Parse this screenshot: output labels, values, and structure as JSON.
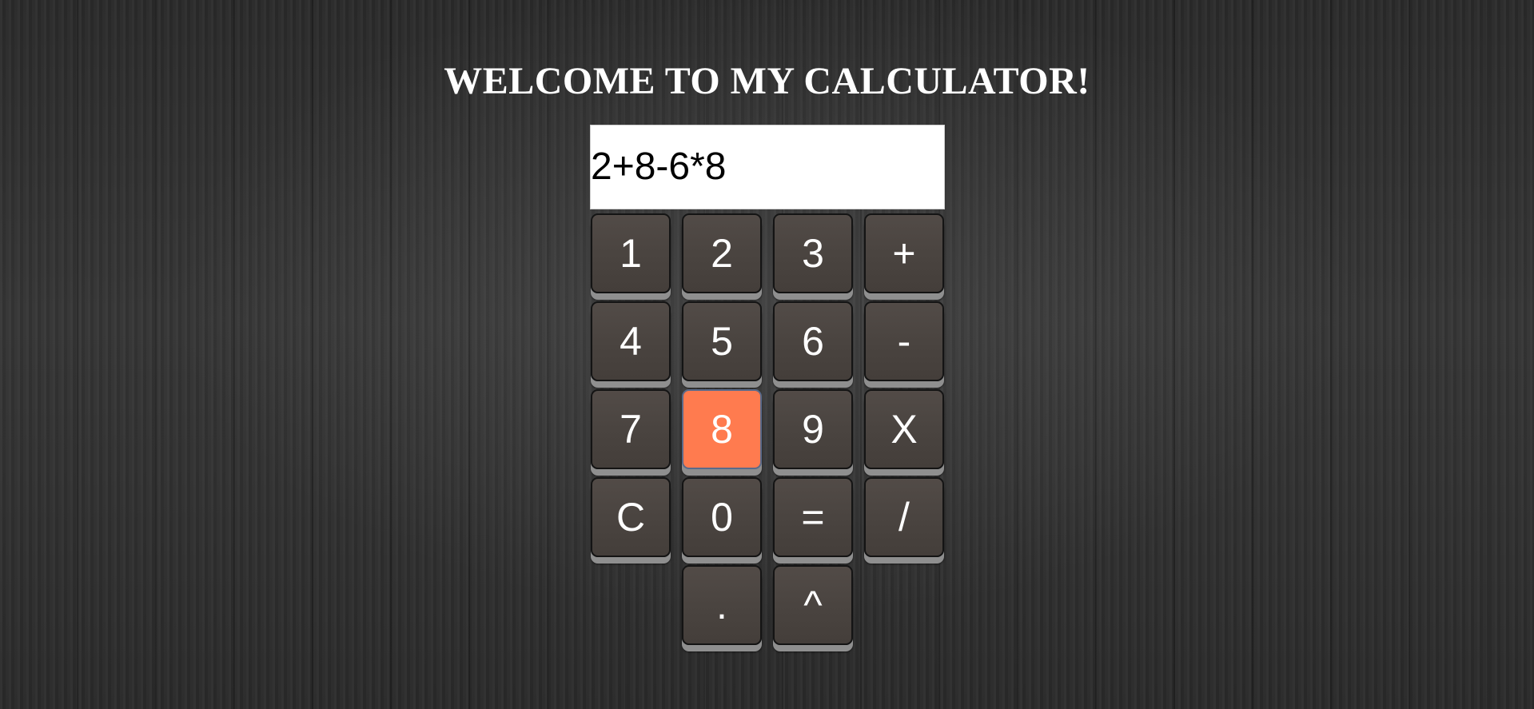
{
  "header": {
    "title": "WELCOME TO MY CALCULATOR!"
  },
  "display": {
    "value": "2+8-6*8"
  },
  "keypad": {
    "keys": [
      "1",
      "2",
      "3",
      "+",
      "4",
      "5",
      "6",
      "-",
      "7",
      "8",
      "9",
      "X",
      "C",
      "0",
      "=",
      "/",
      ".",
      "^"
    ],
    "active_key": "8"
  },
  "colors": {
    "key_background": "#4a4440",
    "key_active": "#ff7b4f",
    "display_background": "#ffffff",
    "title_text": "#ffffff"
  }
}
